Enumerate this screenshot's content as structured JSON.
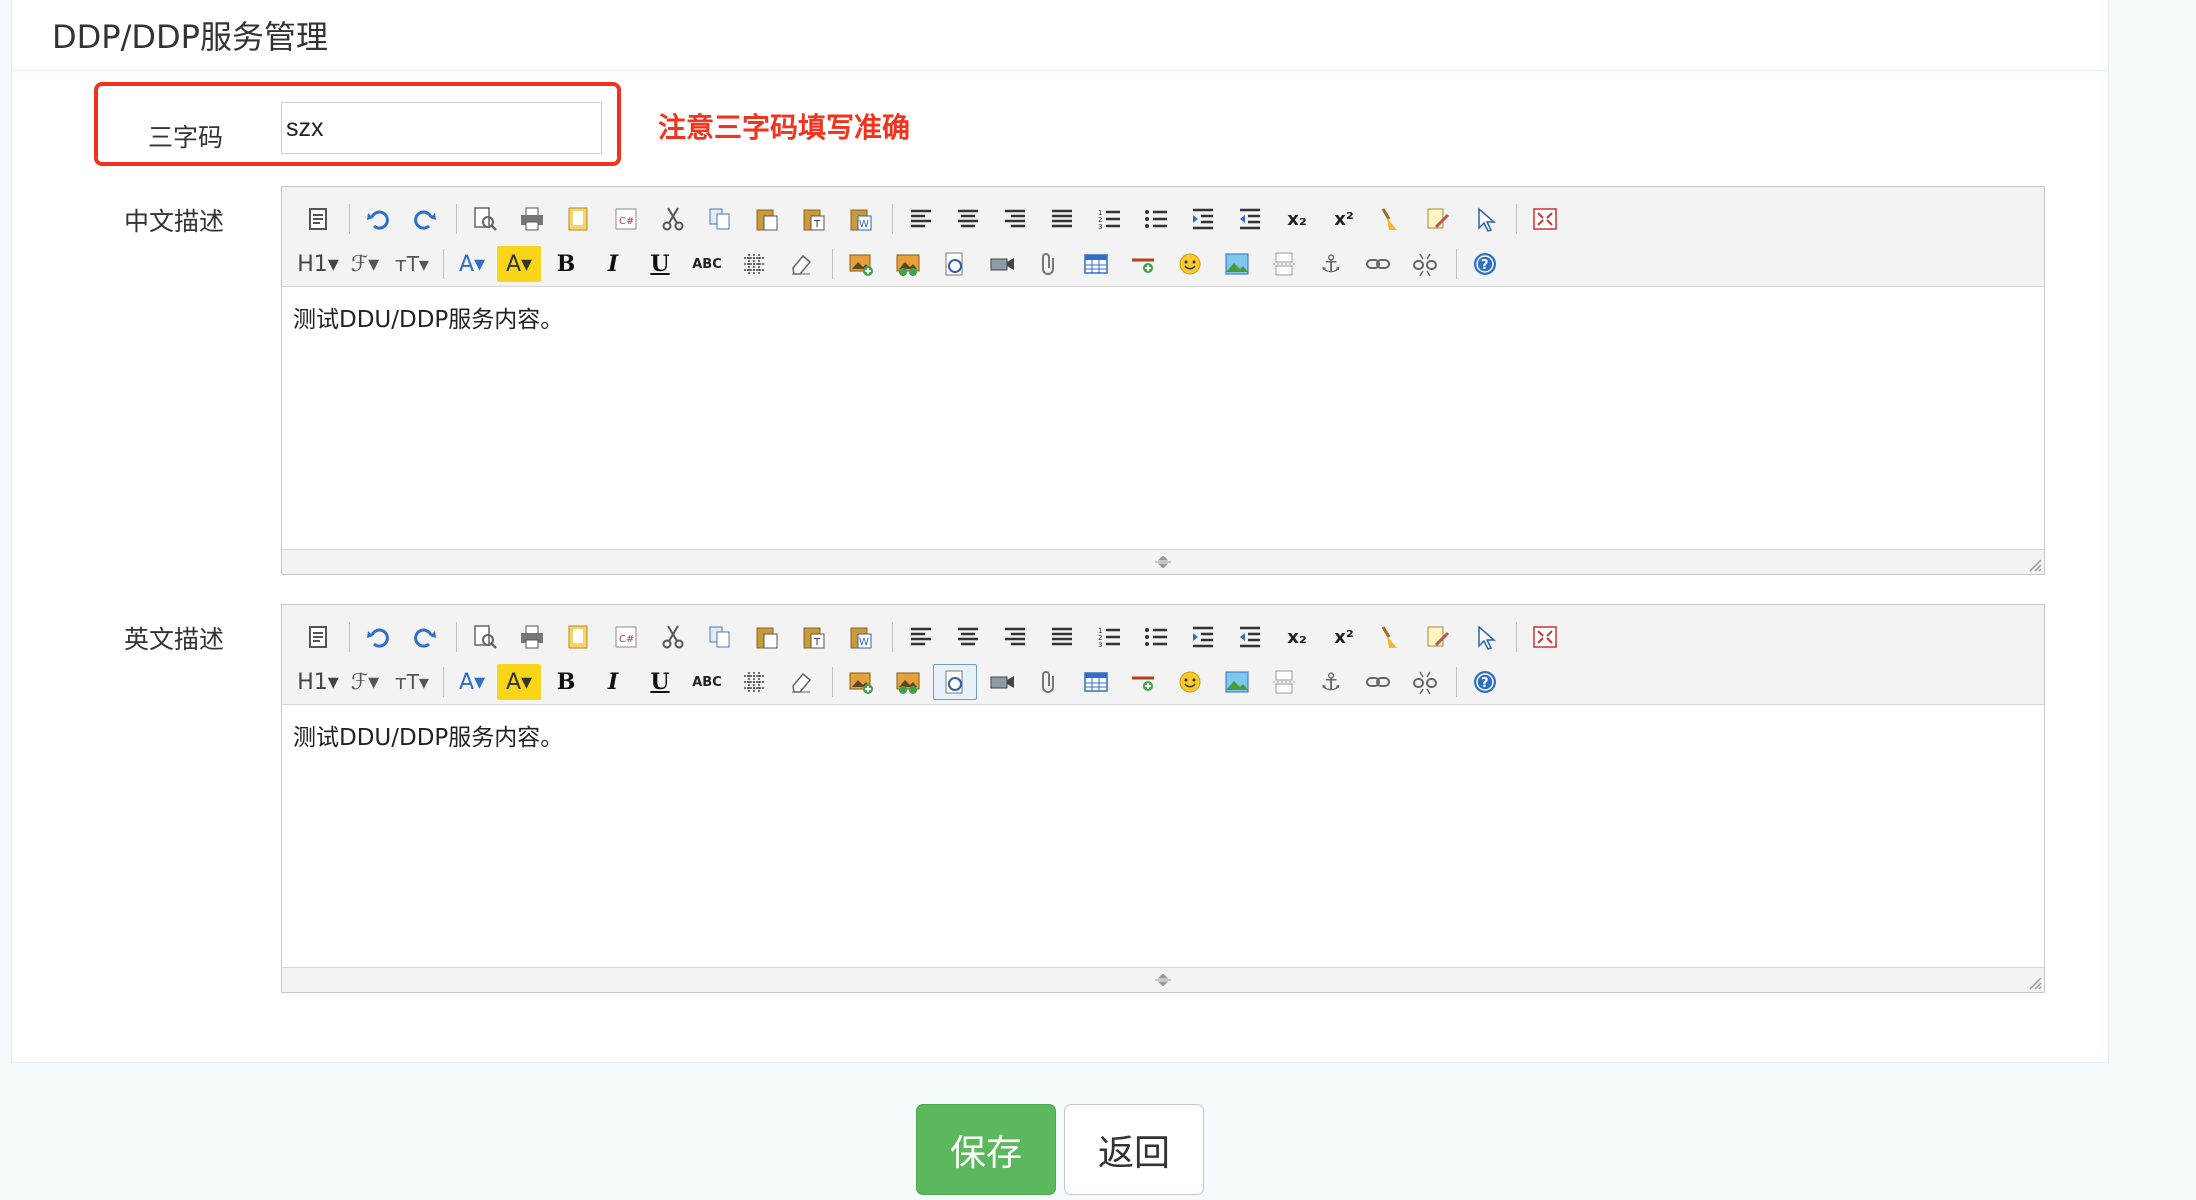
{
  "page": {
    "title": "DDP/DDP服务管理"
  },
  "form": {
    "code_label": "三字码",
    "code_value": "szx",
    "code_hint": "注意三字码填写准确",
    "cn_label": "中文描述",
    "en_label": "英文描述"
  },
  "editors": {
    "cn": {
      "content": "测试DDU/DDP服务内容。"
    },
    "en": {
      "content": "测试DDU/DDP服务内容。"
    }
  },
  "toolbar": {
    "h1": "H1▾",
    "font": "ℱ▾",
    "fontsize": "тT▾",
    "font_color": "A▾",
    "highlight": "A▾",
    "bold": "B",
    "italic": "I",
    "underline": "U",
    "strike": "ABC",
    "subscript": "x₂",
    "superscript": "x²",
    "anchor": "⚓"
  },
  "actions": {
    "save": "保存",
    "back": "返回"
  },
  "colors": {
    "save": "#5cb85c",
    "highlight_box": "#f0321e",
    "hint": "#f2331d"
  }
}
